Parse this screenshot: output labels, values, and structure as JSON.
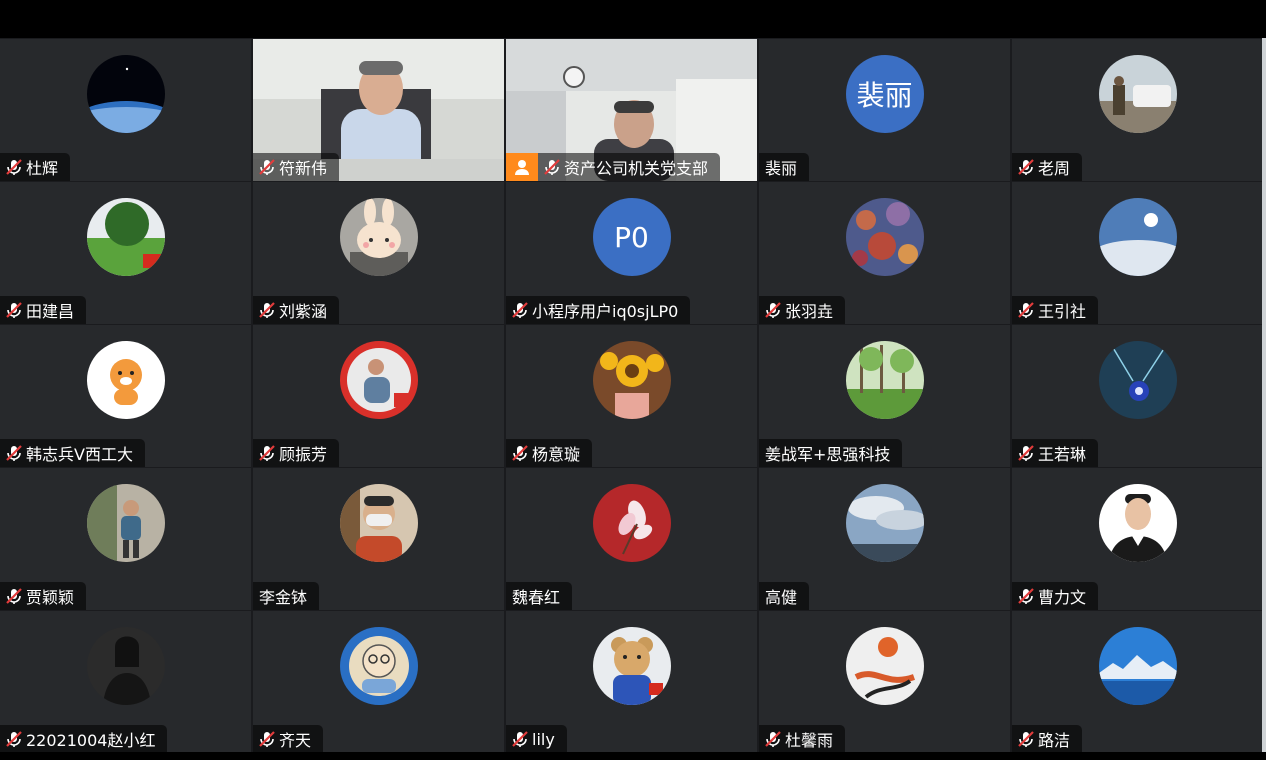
{
  "meeting": {
    "participants": [
      {
        "name": "杜辉",
        "muted": true,
        "avatar": "earth-from-space-photo"
      },
      {
        "name": "符新伟",
        "muted": true,
        "video": "man-at-desk-camera"
      },
      {
        "name": "资产公司机关党支部",
        "muted": true,
        "video": "man-in-office-camera",
        "host_badge": true
      },
      {
        "name": "裴丽",
        "muted": false,
        "initials": "裴丽",
        "color": "#3b6fc4"
      },
      {
        "name": "老周",
        "muted": true,
        "avatar": "person-by-car-photo"
      },
      {
        "name": "田建昌",
        "muted": true,
        "avatar": "garden-photo"
      },
      {
        "name": "刘紫涵",
        "muted": true,
        "avatar": "bunny-cartoon"
      },
      {
        "name": "小程序用户iq0sjLP0",
        "muted": true,
        "initials": "P0",
        "color": "#3b6fc4"
      },
      {
        "name": "张羽垚",
        "muted": true,
        "avatar": "autumn-leaves-photo"
      },
      {
        "name": "王引社",
        "muted": true,
        "avatar": "sky-sun-photo"
      },
      {
        "name": "韩志兵V西工大",
        "muted": true,
        "avatar": "tiger-cartoon"
      },
      {
        "name": "顾振芳",
        "muted": true,
        "avatar": "man-portrait-flag"
      },
      {
        "name": "杨意璇",
        "muted": true,
        "avatar": "sunflowers-photo"
      },
      {
        "name": "姜战军+思强科技",
        "muted": false,
        "avatar": "forest-photo"
      },
      {
        "name": "王若琳",
        "muted": true,
        "avatar": "blue-ornament-photo"
      },
      {
        "name": "贾颖颖",
        "muted": true,
        "avatar": "child-photo"
      },
      {
        "name": "李金钵",
        "muted": false,
        "avatar": "masked-man-photo"
      },
      {
        "name": "魏春红",
        "muted": false,
        "avatar": "magnolia-flower"
      },
      {
        "name": "高健",
        "muted": false,
        "avatar": "cloudy-sky-photo"
      },
      {
        "name": "曹力文",
        "muted": true,
        "avatar": "young-man-portrait"
      },
      {
        "name": "22021004赵小红",
        "muted": true,
        "avatar": "woman-bw-portrait"
      },
      {
        "name": "齐天",
        "muted": true,
        "avatar": "cartoon-grandpa"
      },
      {
        "name": "lily",
        "muted": true,
        "avatar": "teddy-bear-photo"
      },
      {
        "name": "杜馨雨",
        "muted": true,
        "avatar": "abstract-ink-art"
      },
      {
        "name": "路洁",
        "muted": true,
        "avatar": "lake-mountains-photo"
      }
    ]
  },
  "colors": {
    "tile_bg": "#27292c",
    "initials_bg": "#3b6fc4",
    "host_badge": "#ff8a1c"
  }
}
